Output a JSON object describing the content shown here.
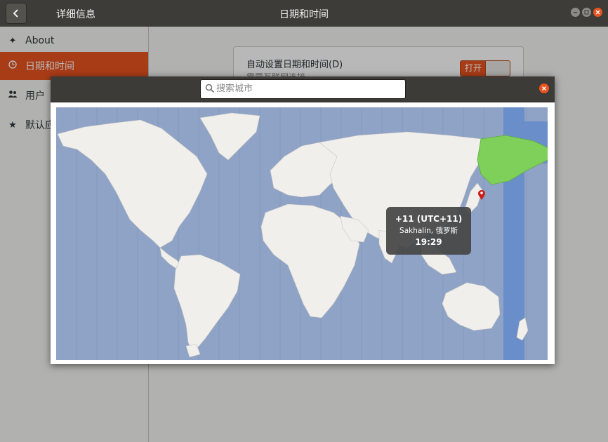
{
  "titlebar": {
    "sidebar_title": "详细信息",
    "main_title": "日期和时间"
  },
  "sidebar": {
    "items": [
      {
        "label": "About",
        "icon": "star-four-point-icon"
      },
      {
        "label": "日期和时间",
        "icon": "clock-icon"
      },
      {
        "label": "用户",
        "icon": "users-icon"
      },
      {
        "label": "默认应",
        "icon": "star-icon"
      }
    ]
  },
  "settings": {
    "auto_time_label": "自动设置日期和时间(D)",
    "auto_time_sublabel": "需要互联网连接",
    "toggle_label": "打开"
  },
  "dialog": {
    "search_placeholder": "搜索城市"
  },
  "tooltip": {
    "offset": "+11 (UTC+11)",
    "city": "Sakhalin, 俄罗斯",
    "time": "19:29"
  },
  "colors": {
    "accent": "#e95420",
    "ocean": "#8fa3c6",
    "land": "#f1efec",
    "selected_zone": "#6a8ec9",
    "selected_land": "#7fd05a",
    "titlebar": "#3d3c38"
  }
}
